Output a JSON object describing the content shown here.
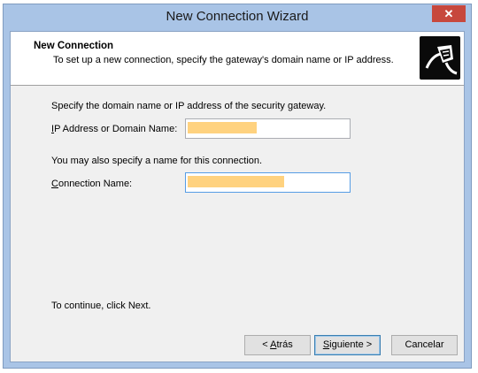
{
  "window": {
    "title": "New Connection Wizard",
    "close_glyph": "✕"
  },
  "header": {
    "title": "New Connection",
    "subtitle": "To set up a new connection, specify the gateway's domain name or IP address.",
    "icon": "network-plug-icon"
  },
  "body": {
    "instruction": "Specify the domain name or IP address of the security gateway.",
    "address_label": {
      "mnemonic": "I",
      "rest": "P Address or Domain Name:"
    },
    "address_value": "",
    "name_instruction": "You may also specify a name for this connection.",
    "name_label": {
      "mnemonic": "C",
      "rest": "onnection Name:"
    },
    "name_value": "",
    "continue_text": "To continue, click Next."
  },
  "redactions": {
    "address_fill_fraction": 0.43,
    "name_fill_fraction": 0.6,
    "color": "#ffd27f"
  },
  "buttons": {
    "back": {
      "pre": "< ",
      "mnemonic": "A",
      "rest": "trás"
    },
    "next": {
      "pre": "",
      "mnemonic": "S",
      "rest": "iguiente >"
    },
    "cancel": "Cancelar"
  },
  "colors": {
    "title_bar": "#a9c4e6",
    "close_button": "#c7483d",
    "dialog_background": "#f0f0f0",
    "focus_border": "#569de5"
  }
}
